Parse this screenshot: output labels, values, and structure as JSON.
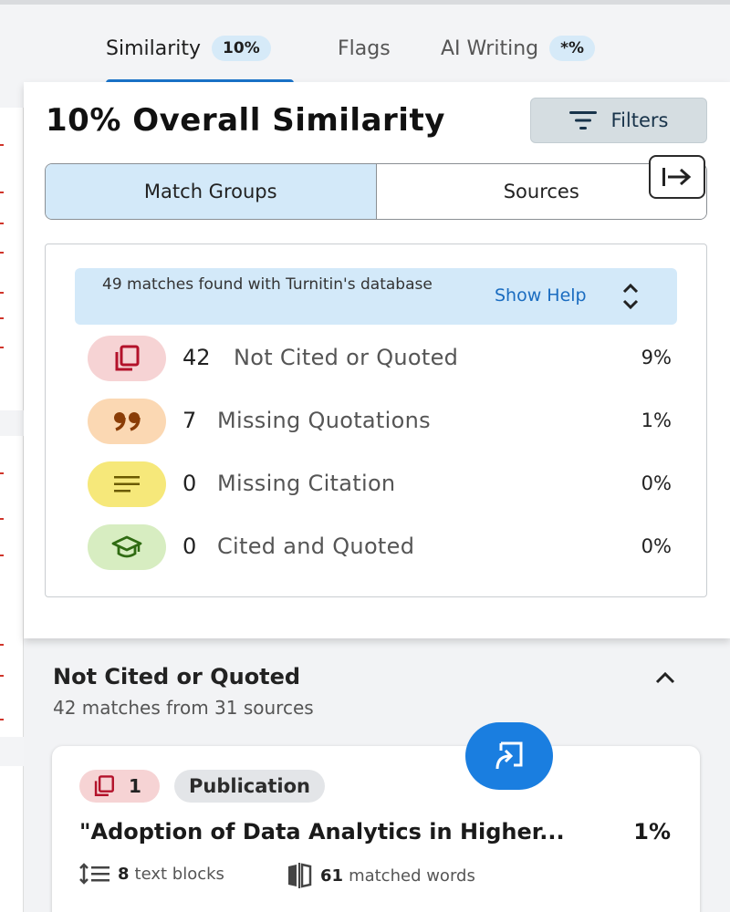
{
  "tabs": [
    {
      "label": "Similarity",
      "badge": "10%"
    },
    {
      "label": "Flags"
    },
    {
      "label": "AI Writing",
      "badge": "*%"
    }
  ],
  "panel": {
    "title": "10% Overall Similarity",
    "filters_label": "Filters",
    "segments": [
      "Match Groups",
      "Sources"
    ]
  },
  "help": {
    "text": "49 matches found with Turnitin's database",
    "link": "Show Help"
  },
  "groups": [
    {
      "count": "42",
      "label": "Not Cited or Quoted",
      "percent": "9%",
      "icon": "copy-icon",
      "color": "#f6d3d4"
    },
    {
      "count": "7",
      "label": "Missing Quotations",
      "percent": "1%",
      "icon": "quote-icon",
      "color": "#fbd8b3"
    },
    {
      "count": "0",
      "label": "Missing Citation",
      "percent": "0%",
      "icon": "lines-icon",
      "color": "#f6e87a"
    },
    {
      "count": "0",
      "label": "Cited and Quoted",
      "percent": "0%",
      "icon": "graduation-cap-icon",
      "color": "#d7edc1"
    }
  ],
  "section": {
    "title": "Not Cited or Quoted",
    "subtitle": "42 matches from 31 sources"
  },
  "source_card": {
    "number": "1",
    "type": "Publication",
    "title": "\"Adoption of Data Analytics in Higher...",
    "percent": "1%",
    "text_blocks": "8",
    "text_blocks_label": "text blocks",
    "matched_words": "61",
    "matched_words_label": "matched words"
  }
}
